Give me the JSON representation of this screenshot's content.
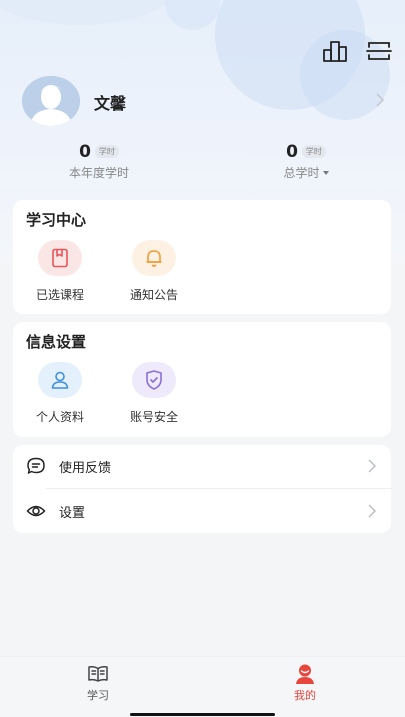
{
  "header": {
    "icons": [
      "ranking-icon",
      "scan-icon"
    ]
  },
  "profile": {
    "name": "文馨"
  },
  "stats": [
    {
      "value": "0",
      "unit": "学时",
      "label": "本年度学时"
    },
    {
      "value": "0",
      "unit": "学时",
      "label": "总学时"
    }
  ],
  "learning_center": {
    "title": "学习中心",
    "items": [
      {
        "label": "已选课程",
        "icon": "book-icon",
        "color": "#e8545a"
      },
      {
        "label": "通知公告",
        "icon": "bell-icon",
        "color": "#f39c34"
      }
    ]
  },
  "info_settings": {
    "title": "信息设置",
    "items": [
      {
        "label": "个人资料",
        "icon": "person-icon",
        "color": "#3f8fdc"
      },
      {
        "label": "账号安全",
        "icon": "shield-icon",
        "color": "#8a6fd9"
      }
    ]
  },
  "menu": [
    {
      "label": "使用反馈",
      "icon": "feedback-icon"
    },
    {
      "label": "设置",
      "icon": "eye-icon"
    }
  ],
  "tabbar": {
    "tabs": [
      {
        "label": "学习",
        "icon": "book-open-icon",
        "active": false
      },
      {
        "label": "我的",
        "icon": "user-icon",
        "active": true
      }
    ],
    "active_color": "#e8463c"
  }
}
